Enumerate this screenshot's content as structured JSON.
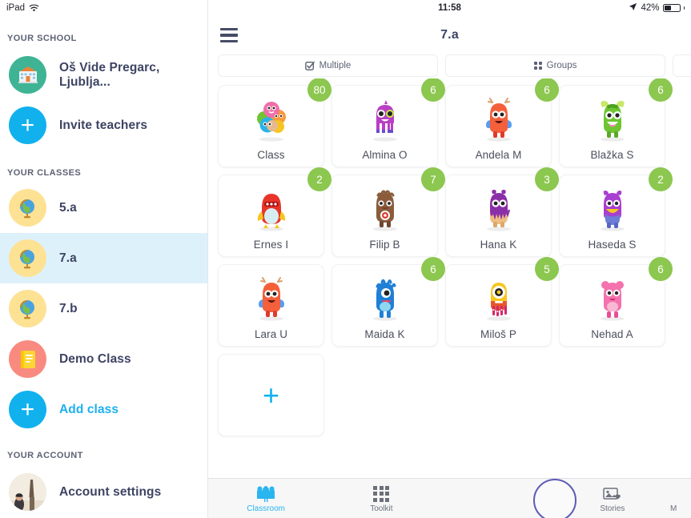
{
  "status_bar": {
    "device": "iPad",
    "wifi_icon": "wifi-icon",
    "time": "11:58",
    "location_icon": "location-arrow-icon",
    "battery_percent": "42%"
  },
  "sidebar": {
    "school_section_label": "YOUR SCHOOL",
    "school": {
      "name": "Oš Vide Pregarc, Ljublja...",
      "icon": "school-building-icon"
    },
    "invite": {
      "label": "Invite teachers",
      "icon": "plus-icon"
    },
    "classes_section_label": "YOUR CLASSES",
    "classes": [
      {
        "label": "5.a",
        "icon": "globe-icon",
        "selected": false
      },
      {
        "label": "7.a",
        "icon": "globe-icon",
        "selected": true
      },
      {
        "label": "7.b",
        "icon": "globe-icon",
        "selected": false
      },
      {
        "label": "Demo Class",
        "icon": "notebook-icon",
        "selected": false
      }
    ],
    "add_class": {
      "label": "Add class",
      "icon": "plus-icon"
    },
    "account_section_label": "YOUR ACCOUNT",
    "account": {
      "label": "Account settings",
      "icon": "avatar-photo"
    }
  },
  "navbar": {
    "menu_icon": "hamburger-menu-icon",
    "title": "7.a"
  },
  "toolbar": {
    "buttons": [
      {
        "label": "Multiple",
        "icon": "checkbox-check-icon"
      },
      {
        "label": "Groups",
        "icon": "four-dots-grid-icon"
      },
      {
        "label": "",
        "icon": ""
      }
    ]
  },
  "students": [
    {
      "name": "Class",
      "points": "80",
      "monster": "group-of-monsters",
      "color": "#f06fa8"
    },
    {
      "name": "Almina O",
      "points": "6",
      "monster": "purple-squid-monster",
      "color": "#b93fc4"
    },
    {
      "name": "Andela M",
      "points": "6",
      "monster": "orange-antler-monster",
      "color": "#f4603a"
    },
    {
      "name": "Blažka S",
      "points": "6",
      "monster": "green-horned-monster",
      "color": "#6fc531"
    },
    {
      "name": "Ernes I",
      "points": "2",
      "monster": "red-rocket-monster",
      "color": "#e8342b"
    },
    {
      "name": "Filip B",
      "points": "7",
      "monster": "brown-furry-monster",
      "color": "#8a5c3c"
    },
    {
      "name": "Hana K",
      "points": "3",
      "monster": "purple-drip-monster",
      "color": "#8b2fa8"
    },
    {
      "name": "Haseda S",
      "points": "2",
      "monster": "violet-beak-monster",
      "color": "#a83fd0"
    },
    {
      "name": "Lara U",
      "points": "",
      "monster": "orange-antler-monster",
      "color": "#f4603a"
    },
    {
      "name": "Maida K",
      "points": "6",
      "monster": "blue-furry-monster",
      "color": "#1f7fd6"
    },
    {
      "name": "Miloš P",
      "points": "5",
      "monster": "yellow-cyclops-monster",
      "color": "#f7c520"
    },
    {
      "name": "Nehad A",
      "points": "6",
      "monster": "pink-bear-monster",
      "color": "#f472ae"
    }
  ],
  "add_student_card": {
    "icon": "plus-icon"
  },
  "tabbar": {
    "tabs": [
      {
        "label": "Classroom",
        "icon": "classroom-monsters-icon",
        "active": true
      },
      {
        "label": "Toolkit",
        "icon": "grid-dots-icon",
        "active": false
      },
      {
        "label": "Stories",
        "icon": "photo-heart-icon",
        "active": false
      },
      {
        "label": "M",
        "icon": "more-icon",
        "active": false
      }
    ]
  },
  "colors": {
    "accent_blue": "#11b1ee",
    "badge_green": "#8cc750",
    "selected_row": "#ddf1fb",
    "text_navy": "#3d4463",
    "cursor_ring": "#5b5bb5"
  }
}
